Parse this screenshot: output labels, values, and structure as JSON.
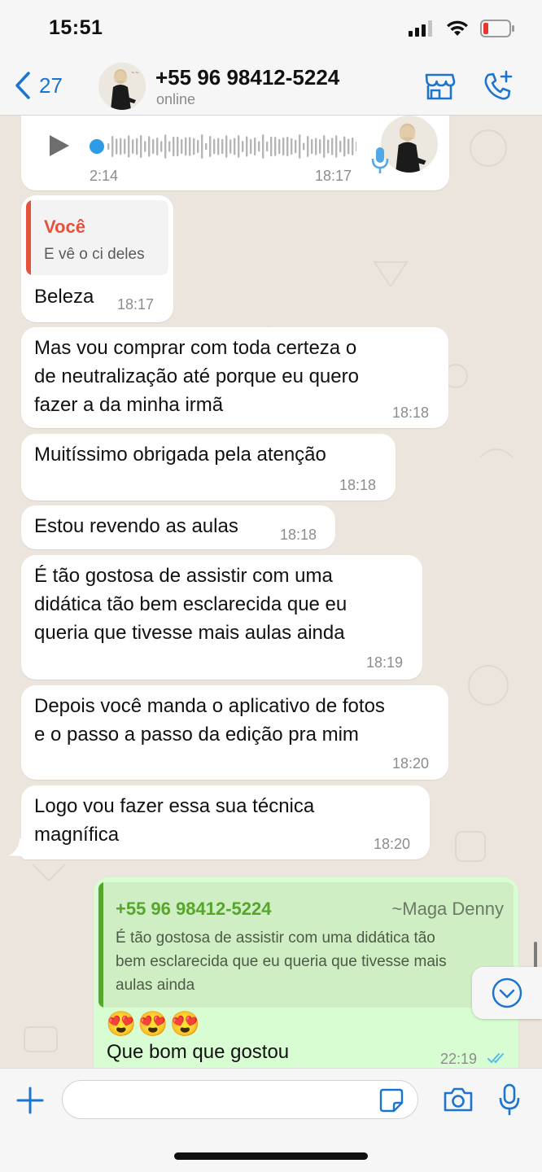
{
  "status_bar": {
    "time": "15:51"
  },
  "header": {
    "back_count": "27",
    "contact_name": "+55 96 98412-5224",
    "contact_status": "online"
  },
  "voice_message": {
    "duration": "2:14",
    "time": "18:17"
  },
  "messages": [
    {
      "quote_author": "Você",
      "quote_text": "E vê o ci deles",
      "text": "Beleza",
      "time": "18:17"
    },
    {
      "text": "Mas vou comprar com toda certeza o\nde neutralização até porque eu quero\nfazer a da minha irmã",
      "time": "18:18"
    },
    {
      "text": "Muitíssimo obrigada pela atenção",
      "time": "18:18"
    },
    {
      "text": "Estou revendo as aulas",
      "time": "18:18"
    },
    {
      "text": "É tão gostosa de assistir com uma\ndidática tão bem esclarecida que eu\nqueria que tivesse mais aulas ainda",
      "time": "18:19"
    },
    {
      "text": "Depois você manda o aplicativo de fotos\ne o passo a passo da edição pra mim",
      "time": "18:20"
    },
    {
      "text": "Logo vou fazer essa sua técnica\nmagnífica",
      "time": "18:20"
    }
  ],
  "outgoing": {
    "quote_number": "+55 96 98412-5224",
    "quote_name": "~Maga Denny",
    "quote_text": "É tão gostosa de assistir com uma didática tão\nbem esclarecida que eu queria que tivesse mais\naulas ainda",
    "emojis": "😍😍😍",
    "text": "Que bom que gostou",
    "time": "22:19"
  },
  "colors": {
    "accent_blue": "#1b75d0",
    "outgoing_bubble": "#d9fdd3",
    "quote_self": "#e5533d",
    "quote_contact_green": "#55a62a",
    "read_ticks": "#53bdeb"
  }
}
